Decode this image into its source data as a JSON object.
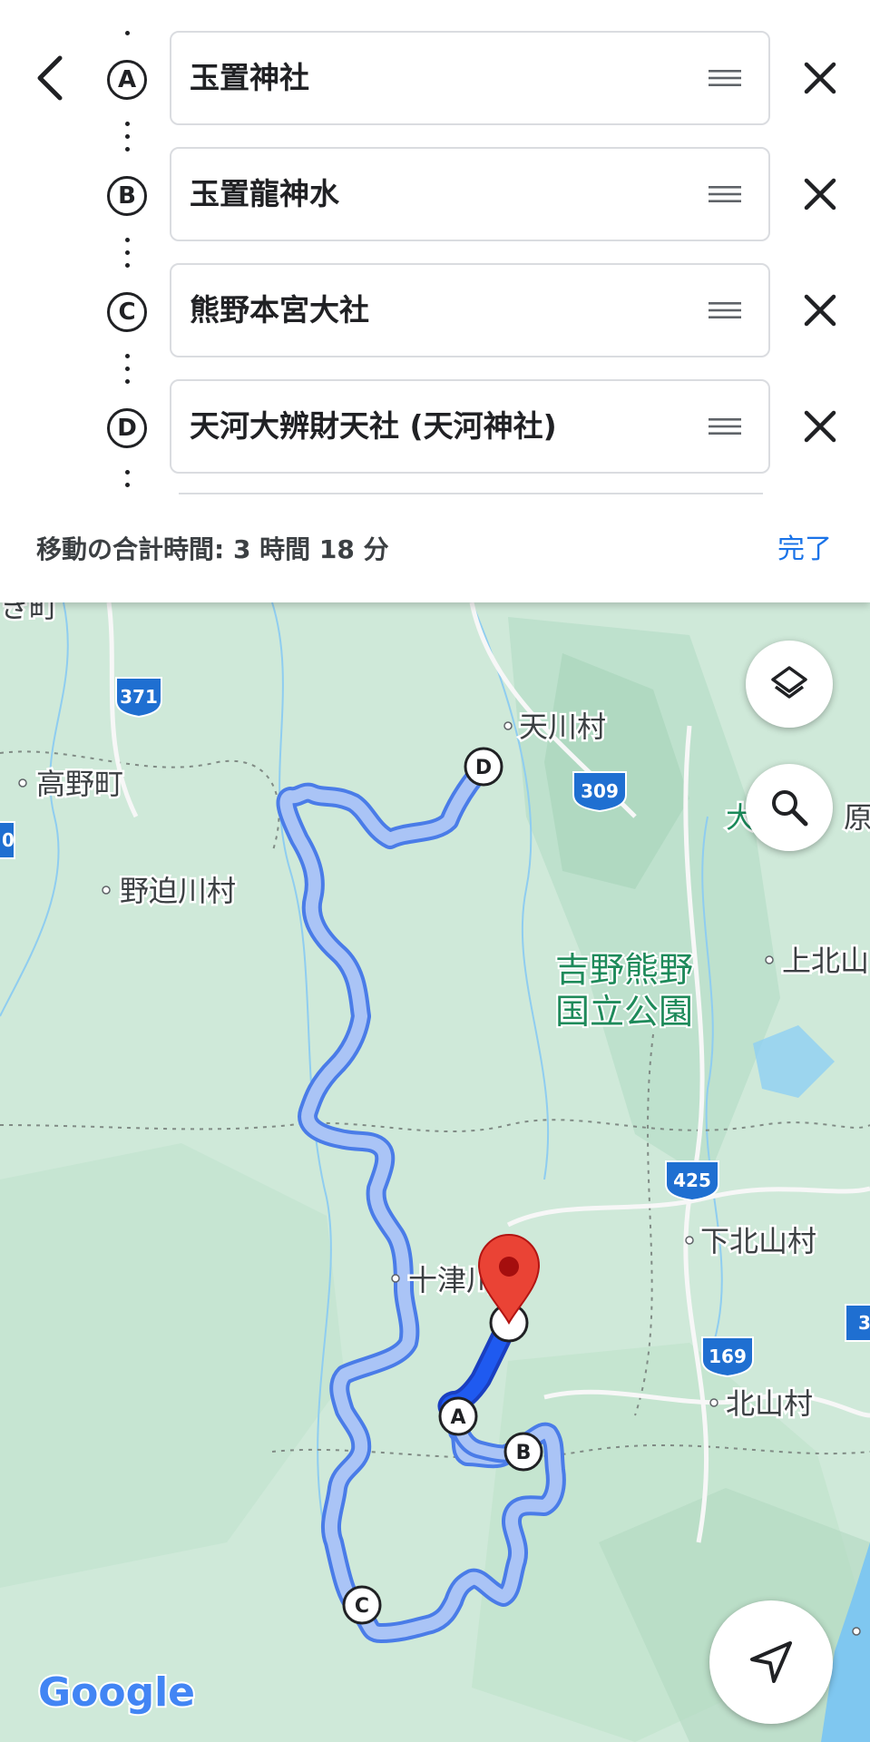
{
  "header": {
    "stops": [
      {
        "letter": "A",
        "name": "玉置神社"
      },
      {
        "letter": "B",
        "name": "玉置龍神水"
      },
      {
        "letter": "C",
        "name": "熊野本宮大社"
      },
      {
        "letter": "D",
        "name": "天河大辨財天社 (天河神社)"
      }
    ],
    "total_time": "移動の合計時間: 3 時間 18 分",
    "done_label": "完了"
  },
  "map": {
    "labels": {
      "mura_top_left": "き町",
      "koya": "高野町",
      "nosegawa": "野迫川村",
      "tenkawa": "天川村",
      "park": "吉野熊野",
      "park2": "国立公園",
      "kamikitayama": "上北山",
      "shimokitayama": "下北山村",
      "totsukawa": "十津川村",
      "kitayama": "北山村",
      "right_partial": "大",
      "right_partial2": "原"
    },
    "roads": {
      "r371": "371",
      "r309": "309",
      "r425": "425",
      "r169": "169",
      "r3": "3",
      "r0": "0"
    },
    "markers": {
      "A": "A",
      "B": "B",
      "C": "C",
      "D": "D"
    },
    "logo": "Google"
  },
  "colors": {
    "route": "#a8c2f5",
    "route_border": "#4a7ce8",
    "route_active": "#1a56e8",
    "pin": "#ea4335",
    "accent": "#1a73e8"
  },
  "icons": {
    "back": "arrow-back-icon",
    "close": "close-icon",
    "drag": "drag-handle-icon",
    "layers": "layers-icon",
    "search": "search-icon",
    "navigate": "navigate-icon"
  }
}
